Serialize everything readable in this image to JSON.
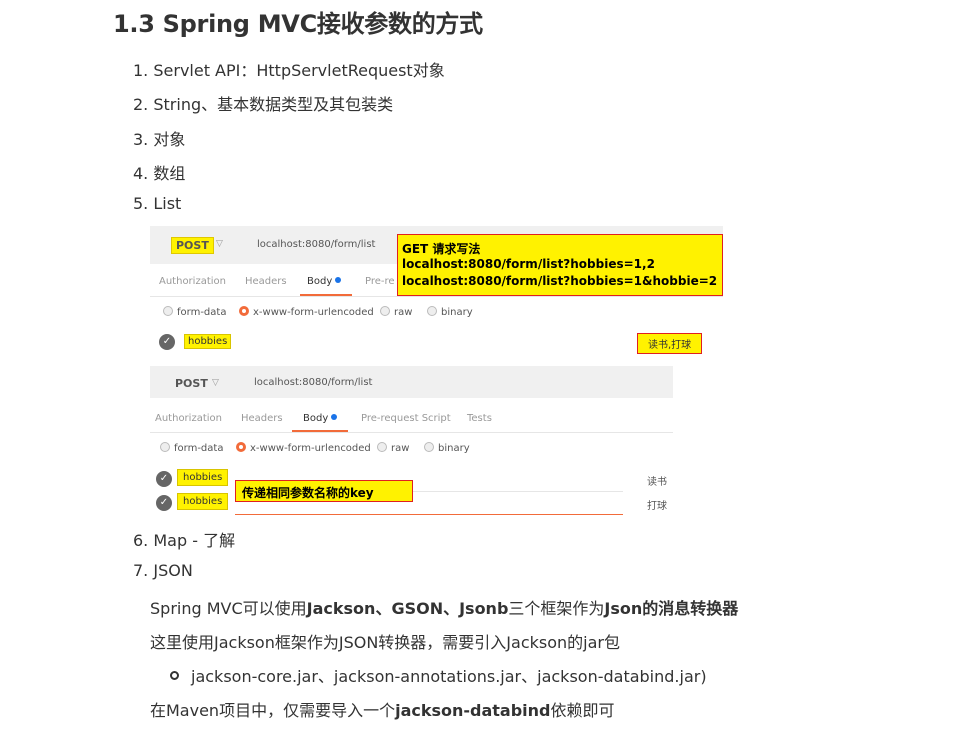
{
  "heading": "1.3 Spring MVC接收参数的方式",
  "list": [
    {
      "num": "1.",
      "text": "Servlet API：HttpServletRequest对象"
    },
    {
      "num": "2.",
      "text": "String、基本数据类型及其包装类"
    },
    {
      "num": "3.",
      "text": "对象"
    },
    {
      "num": "4.",
      "text": "数组"
    },
    {
      "num": "5.",
      "text": "List"
    },
    {
      "num": "6.",
      "text": "Map - 了解"
    },
    {
      "num": "7.",
      "text": "JSON"
    }
  ],
  "screenshot1": {
    "method": "POST",
    "url": "localhost:8080/form/list",
    "tabs": [
      "Authorization",
      "Headers",
      "Body",
      "Pre-re"
    ],
    "options": [
      "form-data",
      "x-www-form-urlencoded",
      "raw",
      "binary"
    ],
    "key": "hobbies",
    "value": "读书,打球",
    "callout": {
      "line1": "GET  请求写法",
      "line2": "localhost:8080/form/list?hobbies=1,2",
      "line3": "localhost:8080/form/list?hobbies=1&hobbie=2"
    }
  },
  "screenshot2": {
    "method": "POST",
    "url": "localhost:8080/form/list",
    "tabs": [
      "Authorization",
      "Headers",
      "Body",
      "Pre-request Script",
      "Tests"
    ],
    "options": [
      "form-data",
      "x-www-form-urlencoded",
      "raw",
      "binary"
    ],
    "key1": "hobbies",
    "key2": "hobbies",
    "value1": "读书",
    "value2": "打球",
    "callout": "传递相同参数名称的key"
  },
  "json_section": {
    "p1_a": "Spring MVC可以使用",
    "p1_b": "Jackson、GSON、Jsonb",
    "p1_c": "三个框架作为",
    "p1_d": "Json的消息转换器",
    "p2": "这里使用Jackson框架作为JSON转换器，需要引入Jackson的jar包",
    "bullet": "jackson-core.jar、jackson-annotations.jar、jackson-databind.jar)",
    "p3_a": "在Maven项目中，仅需要导入一个",
    "p3_b": "jackson-databind",
    "p3_c": "依赖即可"
  },
  "icons": {
    "check": "check-circle-icon",
    "chevron": "chevron-down-icon",
    "radio": "radio-icon",
    "bullet": "bullet-circle-icon"
  },
  "colors": {
    "highlight": "#fff200",
    "callout_border": "#e02020",
    "tab_active": "#f26b3a",
    "dot": "#1a73e8"
  }
}
